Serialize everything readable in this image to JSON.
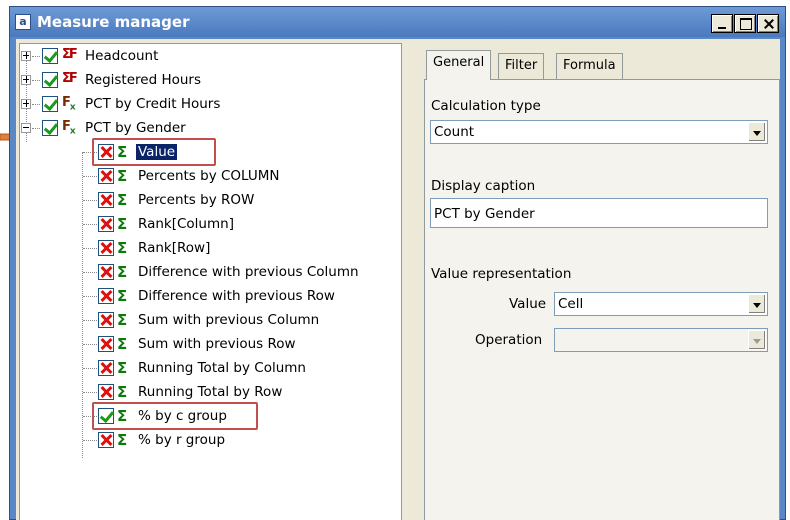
{
  "window": {
    "title": "Measure manager",
    "app_icon_letter": "a"
  },
  "tree": {
    "measures": [
      {
        "label": "Headcount",
        "checked": true,
        "icon": "sigma-f-icon",
        "expanded": false
      },
      {
        "label": "Registered Hours",
        "checked": true,
        "icon": "sigma-f-icon",
        "expanded": false
      },
      {
        "label": "PCT by Credit Hours",
        "checked": true,
        "icon": "fx-icon",
        "expanded": false
      },
      {
        "label": "PCT by Gender",
        "checked": true,
        "icon": "fx-icon",
        "expanded": true
      }
    ],
    "children": [
      {
        "label": "Value",
        "checked": false,
        "selected": true
      },
      {
        "label": "Percents by COLUMN",
        "checked": false
      },
      {
        "label": "Percents by ROW",
        "checked": false
      },
      {
        "label": "Rank[Column]",
        "checked": false
      },
      {
        "label": "Rank[Row]",
        "checked": false
      },
      {
        "label": "Difference with previous Column",
        "checked": false
      },
      {
        "label": "Difference with previous Row",
        "checked": false
      },
      {
        "label": "Sum with previous Column",
        "checked": false
      },
      {
        "label": "Sum with previous Row",
        "checked": false
      },
      {
        "label": "Running Total by Column",
        "checked": false
      },
      {
        "label": "Running Total by Row",
        "checked": false
      },
      {
        "label": "% by c group",
        "checked": true
      },
      {
        "label": "% by r group",
        "checked": false
      }
    ]
  },
  "tabs": [
    {
      "label": "General",
      "active": true
    },
    {
      "label": "Filter",
      "active": false
    },
    {
      "label": "Formula",
      "active": false
    }
  ],
  "general": {
    "calculation_type_label": "Calculation type",
    "calculation_type_value": "Count",
    "display_caption_label": "Display caption",
    "display_caption_value": "PCT by Gender",
    "value_representation_label": "Value representation",
    "value_label": "Value",
    "value_value": "Cell",
    "operation_label": "Operation",
    "operation_value": ""
  },
  "colors": {
    "highlight_box": "#c0504d",
    "titlebar": "#5a88c7",
    "selection": "#0a246a"
  }
}
